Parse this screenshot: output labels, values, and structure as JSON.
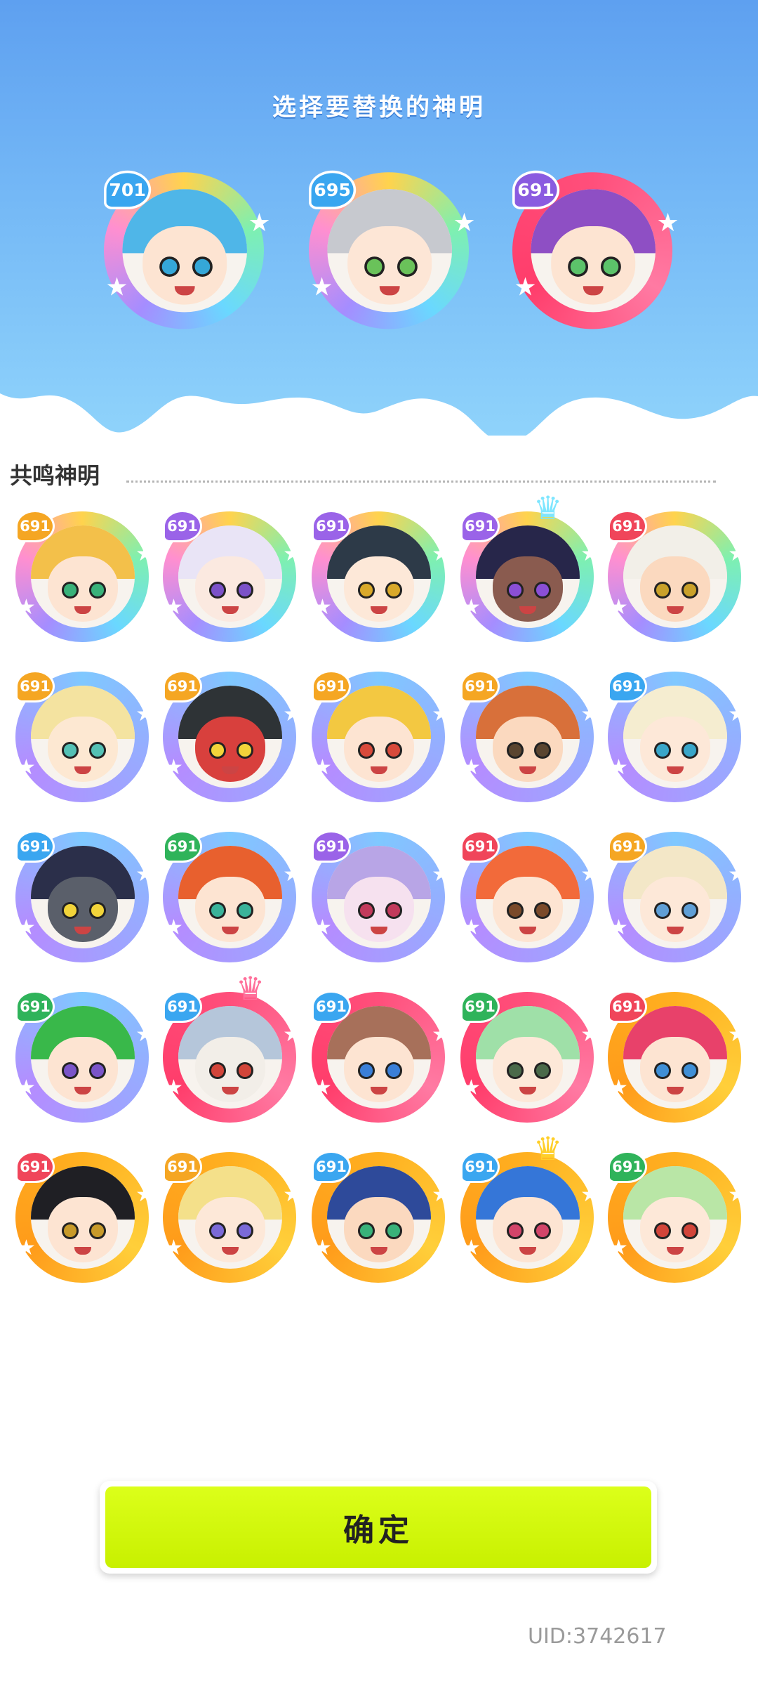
{
  "header": {
    "title": "选择要替换的神明"
  },
  "selected": [
    {
      "level": "701",
      "badge_color": "#3aa6f0",
      "ring": "rainbow",
      "hair": "#4fb6e8",
      "skin": "#fde4d2",
      "eye": "#35a7d8"
    },
    {
      "level": "695",
      "badge_color": "#3aa6f0",
      "ring": "rainbow",
      "hair": "#c7c9cf",
      "skin": "#fde6d6",
      "eye": "#6ac25a"
    },
    {
      "level": "691",
      "badge_color": "#8a5be0",
      "ring": "pink",
      "hair": "#8e4fc4",
      "skin": "#fde4d2",
      "eye": "#5cc36a"
    }
  ],
  "section": {
    "label": "共鸣神明"
  },
  "gods": [
    {
      "level": "691",
      "badge": "#f5a623",
      "ring": "rainbow",
      "hair": "#f3c04a",
      "skin": "#fde4d2",
      "eye": "#39b27a",
      "crown": null
    },
    {
      "level": "691",
      "badge": "#9a63e8",
      "ring": "rainbow",
      "hair": "#e9e4f6",
      "skin": "#fbe9e0",
      "eye": "#7b52c9",
      "crown": null
    },
    {
      "level": "691",
      "badge": "#9a63e8",
      "ring": "rainbow",
      "hair": "#2d3a48",
      "skin": "#fde8d8",
      "eye": "#d9a92a",
      "crown": null
    },
    {
      "level": "691",
      "badge": "#9a63e8",
      "ring": "rainbow",
      "hair": "#27264a",
      "skin": "#8a5b4f",
      "eye": "#8a4fd6",
      "crown": "teal"
    },
    {
      "level": "691",
      "badge": "#f0455a",
      "ring": "rainbow",
      "hair": "#f2efe8",
      "skin": "#fbd9bf",
      "eye": "#c9a12a",
      "crown": null
    },
    {
      "level": "691",
      "badge": "#f5a623",
      "ring": "blue",
      "hair": "#f4e3a0",
      "skin": "#fde8d2",
      "eye": "#54c1b5",
      "crown": null
    },
    {
      "level": "691",
      "badge": "#f5a623",
      "ring": "blue",
      "hair": "#2e3336",
      "skin": "#d8403d",
      "eye": "#f2d43a",
      "crown": null
    },
    {
      "level": "691",
      "badge": "#f5a623",
      "ring": "blue",
      "hair": "#f3c841",
      "skin": "#fde4d2",
      "eye": "#d84a3b",
      "crown": null
    },
    {
      "level": "691",
      "badge": "#f5a623",
      "ring": "blue",
      "hair": "#d8703a",
      "skin": "#fbd9bf",
      "eye": "#5a4530",
      "crown": null
    },
    {
      "level": "691",
      "badge": "#3aa6f0",
      "ring": "blue",
      "hair": "#f5edd0",
      "skin": "#fde8d8",
      "eye": "#39a6c9",
      "crown": null
    },
    {
      "level": "691",
      "badge": "#3aa6f0",
      "ring": "blue",
      "hair": "#2b2f4a",
      "skin": "#5a5f6a",
      "eye": "#f2d43a",
      "crown": null
    },
    {
      "level": "691",
      "badge": "#2fb35a",
      "ring": "blue",
      "hair": "#e8602e",
      "skin": "#fde4d2",
      "eye": "#3ab39a",
      "crown": null
    },
    {
      "level": "691",
      "badge": "#9a63e8",
      "ring": "blue",
      "hair": "#b8a5e6",
      "skin": "#f6e1ef",
      "eye": "#c23a5c",
      "crown": null
    },
    {
      "level": "691",
      "badge": "#f0455a",
      "ring": "blue",
      "hair": "#f26a3a",
      "skin": "#fde4d2",
      "eye": "#7a4a2a",
      "crown": null
    },
    {
      "level": "691",
      "badge": "#f5a623",
      "ring": "blue",
      "hair": "#f3e7c7",
      "skin": "#fde8d8",
      "eye": "#5f9fd6",
      "crown": null
    },
    {
      "level": "691",
      "badge": "#2fb35a",
      "ring": "blue",
      "hair": "#39b84a",
      "skin": "#fde4d2",
      "eye": "#7a55c9",
      "crown": null
    },
    {
      "level": "691",
      "badge": "#3aa6f0",
      "ring": "pink",
      "hair": "#b5c6da",
      "skin": "#f2eee8",
      "eye": "#d2453a",
      "crown": "pink"
    },
    {
      "level": "691",
      "badge": "#3aa6f0",
      "ring": "pink",
      "hair": "#a7705a",
      "skin": "#fde4d2",
      "eye": "#3a7fd8",
      "crown": null
    },
    {
      "level": "691",
      "badge": "#2fb35a",
      "ring": "pink",
      "hair": "#9fe0a8",
      "skin": "#fde8d8",
      "eye": "#4a6a4a",
      "crown": null
    },
    {
      "level": "691",
      "badge": "#f0455a",
      "ring": "orange",
      "hair": "#e8416a",
      "skin": "#fde4d2",
      "eye": "#3f8fd6",
      "crown": null
    },
    {
      "level": "691",
      "badge": "#f0455a",
      "ring": "orange",
      "hair": "#1f1f24",
      "skin": "#fde4d2",
      "eye": "#c79a2a",
      "crown": null
    },
    {
      "level": "691",
      "badge": "#f5a623",
      "ring": "orange",
      "hair": "#f4e08a",
      "skin": "#fde8d8",
      "eye": "#7a6ad8",
      "crown": null
    },
    {
      "level": "691",
      "badge": "#3aa6f0",
      "ring": "orange",
      "hair": "#2e4a9a",
      "skin": "#fbd9bf",
      "eye": "#39b27a",
      "crown": null
    },
    {
      "level": "691",
      "badge": "#3aa6f0",
      "ring": "orange",
      "hair": "#3576d8",
      "skin": "#fde4d2",
      "eye": "#d2456a",
      "crown": "gold"
    },
    {
      "level": "691",
      "badge": "#2fb35a",
      "ring": "orange",
      "hair": "#b9e6a6",
      "skin": "#fde8d8",
      "eye": "#d2453a",
      "crown": null
    }
  ],
  "confirm": {
    "label": "确定"
  },
  "footer": {
    "uid": "UID:3742617"
  }
}
